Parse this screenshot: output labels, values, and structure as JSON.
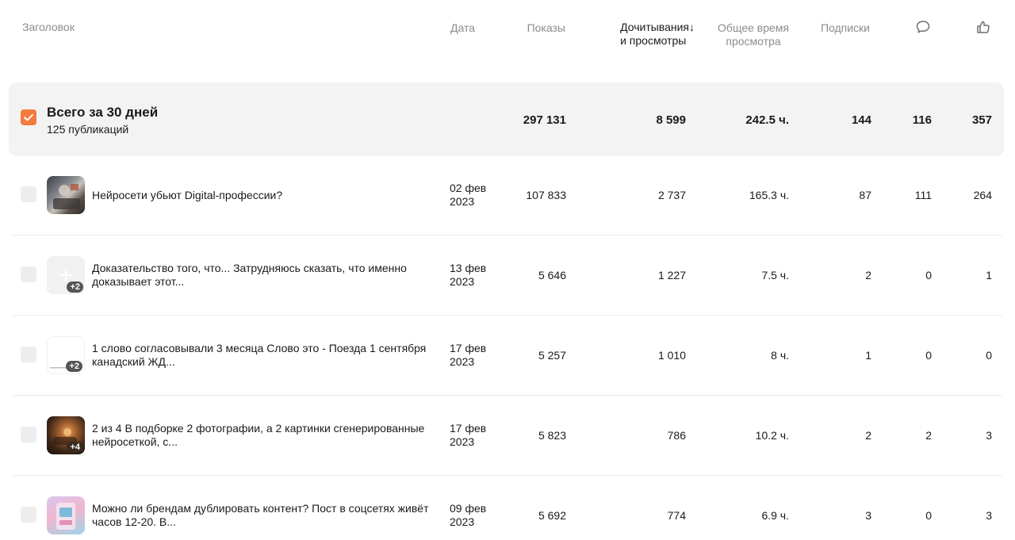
{
  "header": {
    "title": "Заголовок",
    "date": "Дата",
    "views": "Показы",
    "reads_line1": "Дочитывания↓",
    "reads_line2": "и просмотры",
    "time_line1": "Общее время",
    "time_line2": "просмотра",
    "subs": "Подписки",
    "comments_icon": "comment-icon",
    "likes_icon": "thumbs-up-icon"
  },
  "colors": {
    "accent": "#f47b3c",
    "total_bg": "#f3f3f3",
    "muted": "#8c8c8c"
  },
  "total": {
    "title": "Всего за 30 дней",
    "subtitle": "125 публикаций",
    "views": "297 131",
    "reads": "8 599",
    "time": "242.5 ч.",
    "subs": "144",
    "comments": "116",
    "likes": "357"
  },
  "rows": [
    {
      "title": "Нейросети убьют Digital-профессии?",
      "date1": "02 фев",
      "date2": "2023",
      "views": "107 833",
      "reads": "2 737",
      "time": "165.3 ч.",
      "subs": "87",
      "comments": "111",
      "likes": "264",
      "badge": ""
    },
    {
      "title": "Доказательство того, что... Затрудняюсь сказать, что именно доказывает этот...",
      "date1": "13 фев",
      "date2": "2023",
      "views": "5 646",
      "reads": "1 227",
      "time": "7.5 ч.",
      "subs": "2",
      "comments": "0",
      "likes": "1",
      "badge": "+2"
    },
    {
      "title": "1 слово согласовывали 3 месяца Слово это - Поезда 1 сентября канадский ЖД...",
      "date1": "17 фев",
      "date2": "2023",
      "views": "5 257",
      "reads": "1 010",
      "time": "8 ч.",
      "subs": "1",
      "comments": "0",
      "likes": "0",
      "badge": "+2"
    },
    {
      "title": "2 из 4 В подборке 2 фотографии, а 2 картинки сгенерированные нейросеткой, с...",
      "date1": "17 фев",
      "date2": "2023",
      "views": "5 823",
      "reads": "786",
      "time": "10.2 ч.",
      "subs": "2",
      "comments": "2",
      "likes": "3",
      "badge": "+4"
    },
    {
      "title": "Можно ли брендам дублировать контент? Пост в соцсетях живёт часов 12-20. В...",
      "date1": "09 фев",
      "date2": "2023",
      "views": "5 692",
      "reads": "774",
      "time": "6.9 ч.",
      "subs": "3",
      "comments": "0",
      "likes": "3",
      "badge": ""
    }
  ]
}
